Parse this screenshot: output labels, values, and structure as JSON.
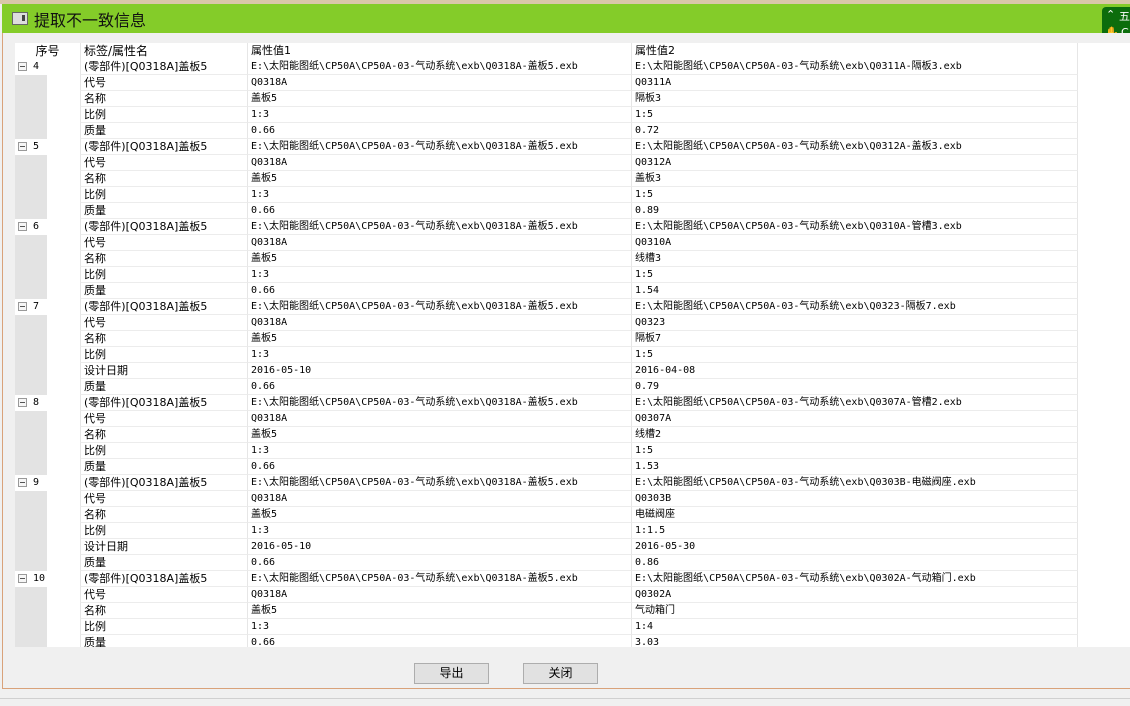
{
  "window": {
    "title": "提取不一致信息",
    "widget_top": "五",
    "widget_bottom": "C"
  },
  "headers": {
    "seq": "序号",
    "label": "标签/属性名",
    "val1": "属性值1",
    "val2": "属性值2"
  },
  "groups": [
    {
      "num": "4",
      "label": "(零部件)[Q0318A]盖板5",
      "val1": "E:\\太阳能图纸\\CP50A\\CP50A-03-气动系统\\exb\\Q0318A-盖板5.exb",
      "val2": "E:\\太阳能图纸\\CP50A\\CP50A-03-气动系统\\exb\\Q0311A-隔板3.exb",
      "rows": [
        [
          "代号",
          "Q0318A",
          "Q0311A"
        ],
        [
          "名称",
          "盖板5",
          "隔板3"
        ],
        [
          "比例",
          "1:3",
          "1:5"
        ],
        [
          "质量",
          "0.66",
          "0.72"
        ]
      ]
    },
    {
      "num": "5",
      "label": "(零部件)[Q0318A]盖板5",
      "val1": "E:\\太阳能图纸\\CP50A\\CP50A-03-气动系统\\exb\\Q0318A-盖板5.exb",
      "val2": "E:\\太阳能图纸\\CP50A\\CP50A-03-气动系统\\exb\\Q0312A-盖板3.exb",
      "rows": [
        [
          "代号",
          "Q0318A",
          "Q0312A"
        ],
        [
          "名称",
          "盖板5",
          "盖板3"
        ],
        [
          "比例",
          "1:3",
          "1:5"
        ],
        [
          "质量",
          "0.66",
          "0.89"
        ]
      ]
    },
    {
      "num": "6",
      "label": "(零部件)[Q0318A]盖板5",
      "val1": "E:\\太阳能图纸\\CP50A\\CP50A-03-气动系统\\exb\\Q0318A-盖板5.exb",
      "val2": "E:\\太阳能图纸\\CP50A\\CP50A-03-气动系统\\exb\\Q0310A-管槽3.exb",
      "rows": [
        [
          "代号",
          "Q0318A",
          "Q0310A"
        ],
        [
          "名称",
          "盖板5",
          "线槽3"
        ],
        [
          "比例",
          "1:3",
          "1:5"
        ],
        [
          "质量",
          "0.66",
          "1.54"
        ]
      ]
    },
    {
      "num": "7",
      "label": "(零部件)[Q0318A]盖板5",
      "val1": "E:\\太阳能图纸\\CP50A\\CP50A-03-气动系统\\exb\\Q0318A-盖板5.exb",
      "val2": "E:\\太阳能图纸\\CP50A\\CP50A-03-气动系统\\exb\\Q0323-隔板7.exb",
      "rows": [
        [
          "代号",
          "Q0318A",
          "Q0323"
        ],
        [
          "名称",
          "盖板5",
          "隔板7"
        ],
        [
          "比例",
          "1:3",
          "1:5"
        ],
        [
          "设计日期",
          "2016-05-10",
          "2016-04-08"
        ],
        [
          "质量",
          "0.66",
          "0.79"
        ]
      ]
    },
    {
      "num": "8",
      "label": "(零部件)[Q0318A]盖板5",
      "val1": "E:\\太阳能图纸\\CP50A\\CP50A-03-气动系统\\exb\\Q0318A-盖板5.exb",
      "val2": "E:\\太阳能图纸\\CP50A\\CP50A-03-气动系统\\exb\\Q0307A-管槽2.exb",
      "rows": [
        [
          "代号",
          "Q0318A",
          "Q0307A"
        ],
        [
          "名称",
          "盖板5",
          "线槽2"
        ],
        [
          "比例",
          "1:3",
          "1:5"
        ],
        [
          "质量",
          "0.66",
          "1.53"
        ]
      ]
    },
    {
      "num": "9",
      "label": "(零部件)[Q0318A]盖板5",
      "val1": "E:\\太阳能图纸\\CP50A\\CP50A-03-气动系统\\exb\\Q0318A-盖板5.exb",
      "val2": "E:\\太阳能图纸\\CP50A\\CP50A-03-气动系统\\exb\\Q0303B-电磁阀座.exb",
      "rows": [
        [
          "代号",
          "Q0318A",
          "Q0303B"
        ],
        [
          "名称",
          "盖板5",
          "电磁阀座"
        ],
        [
          "比例",
          "1:3",
          "1:1.5"
        ],
        [
          "设计日期",
          "2016-05-10",
          "2016-05-30"
        ],
        [
          "质量",
          "0.66",
          "0.86"
        ]
      ]
    },
    {
      "num": "10",
      "label": "(零部件)[Q0318A]盖板5",
      "val1": "E:\\太阳能图纸\\CP50A\\CP50A-03-气动系统\\exb\\Q0318A-盖板5.exb",
      "val2": "E:\\太阳能图纸\\CP50A\\CP50A-03-气动系统\\exb\\Q0302A-气动箱门.exb",
      "rows": [
        [
          "代号",
          "Q0318A",
          "Q0302A"
        ],
        [
          "名称",
          "盖板5",
          "气动箱门"
        ],
        [
          "比例",
          "1:3",
          "1:4"
        ],
        [
          "质量",
          "0.66",
          "3.03"
        ]
      ]
    }
  ],
  "buttons": {
    "export": "导出",
    "close": "关闭"
  }
}
